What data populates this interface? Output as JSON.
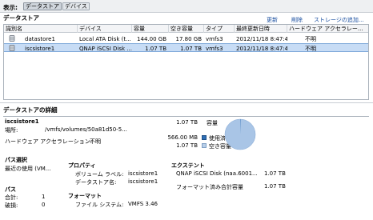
{
  "viewbar": {
    "label": "表示:",
    "btn_datastores": "データストア",
    "btn_devices": "デバイス"
  },
  "datastores": {
    "title": "データストア",
    "actions": {
      "refresh": "更新",
      "delete": "削除",
      "add_storage": "ストレージの追加..."
    },
    "columns": [
      "識別名",
      "デバイス",
      "容量",
      "空き容量",
      "タイプ",
      "最終更新日時",
      "ハードウェア アクセラレー..."
    ],
    "rows": [
      {
        "name": "datastore1",
        "device": "Local ATA Disk (t...",
        "capacity": "144.00 GB",
        "free": "17.80 GB",
        "type": "vmfs3",
        "updated": "2012/11/18 8:47:49",
        "hw_accel": "不明",
        "selected": false
      },
      {
        "name": "iscsistore1",
        "device": "QNAP iSCSI Disk ...",
        "capacity": "1.07 TB",
        "free": "1.07 TB",
        "type": "vmfs3",
        "updated": "2012/11/18 8:47:49",
        "hw_accel": "不明",
        "selected": true
      }
    ]
  },
  "details": {
    "title": "データストアの詳細",
    "name": "iscsistore1",
    "location_label": "場所:",
    "location_value": "/vmfs/volumes/50a81d50-5...",
    "hw_accel_label": "ハードウェア アクセラレーション:",
    "hw_accel_value": "不明",
    "total_capacity": "1.07 TB",
    "capacity_label": "容量",
    "used_value": "566.00 MB",
    "used_label": "使用済み",
    "free_value": "1.07 TB",
    "free_label": "空き容量",
    "used_fraction": 0.0005,
    "colors": {
      "used": "#2e6fb6",
      "free": "#b9cfe9",
      "pie": "#a9c5e6"
    },
    "path_selection": {
      "title": "パス選択",
      "value": "最近の使用 (VM..."
    },
    "paths": {
      "title": "パス",
      "total_label": "合計:",
      "total_value": "1",
      "broken_label": "破損:",
      "broken_value": "0"
    },
    "properties": {
      "title": "プロパティ",
      "volume_label": "ボリューム ラベル:",
      "volume_value": "iscsistore1",
      "ds_name_label": "データストア名:",
      "ds_name_value": "iscsistore1"
    },
    "format": {
      "title": "フォーマット",
      "fs_label": "ファイル システム:",
      "fs_value": "VMFS 3.46"
    },
    "extents": {
      "title": "エクステント",
      "item": "QNAP iSCSI Disk (naa.6001...",
      "item_value": "1.07 TB",
      "total_label": "フォーマット済み合計容量",
      "total_value": "1.07 TB"
    }
  }
}
